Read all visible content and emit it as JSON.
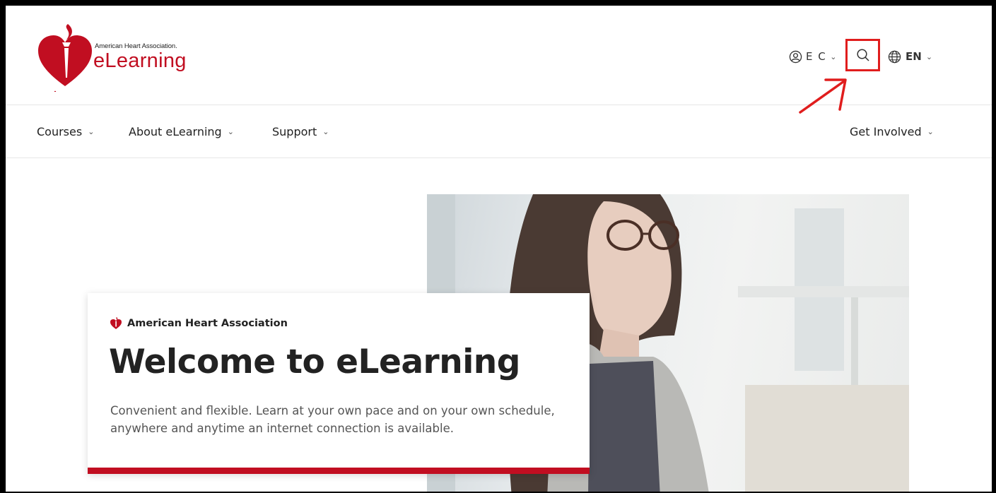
{
  "header": {
    "logo_small_text": "American Heart Association.",
    "logo_big_text": "eLearning",
    "user_initials": "E C",
    "language": "EN"
  },
  "nav": {
    "items": [
      {
        "label": "Courses"
      },
      {
        "label": "About eLearning"
      },
      {
        "label": "Support"
      },
      {
        "label": "Get Involved"
      }
    ]
  },
  "hero": {
    "brand": "American Heart Association",
    "title": "Welcome to eLearning",
    "description": "Convenient and flexible. Learn at your own pace and on your own schedule, anywhere and anytime an internet connection is available."
  },
  "colors": {
    "brand_red": "#c10e21",
    "annotation_red": "#e01d1d"
  },
  "icons": [
    "heart-torch-logo-icon",
    "user-icon",
    "chevron-down-icon",
    "search-icon",
    "globe-icon",
    "annotation-arrow-icon"
  ]
}
